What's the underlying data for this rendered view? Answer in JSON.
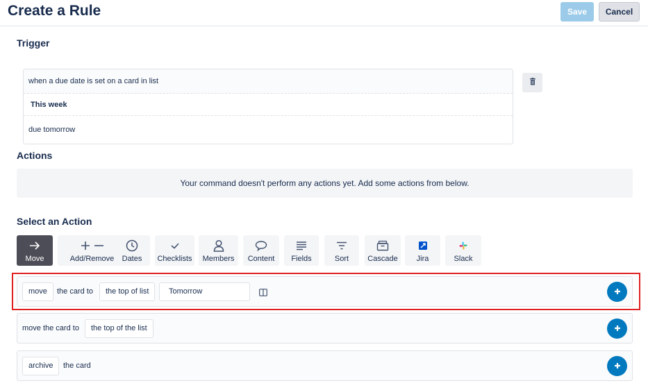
{
  "header": {
    "title": "Create a Rule",
    "save_label": "Save",
    "cancel_label": "Cancel"
  },
  "trigger": {
    "heading": "Trigger",
    "row1": "when a due date is set on a card in list",
    "row2": "This week",
    "row3": "due tomorrow",
    "delete_icon": "trash-icon"
  },
  "actions": {
    "heading": "Actions",
    "empty_message": "Your command doesn't perform any actions yet. Add some actions from below."
  },
  "select_action": {
    "heading": "Select an Action",
    "tabs": [
      {
        "label": "Move",
        "icon": "arrow-right-icon",
        "active": true
      },
      {
        "label": "Add/Remove",
        "icon": "plus-minus-icon",
        "active": false
      },
      {
        "label": "Dates",
        "icon": "clock-icon",
        "active": false
      },
      {
        "label": "Checklists",
        "icon": "checkmark-icon",
        "active": false
      },
      {
        "label": "Members",
        "icon": "person-icon",
        "active": false
      },
      {
        "label": "Content",
        "icon": "speech-bubble-icon",
        "active": false
      },
      {
        "label": "Fields",
        "icon": "lines-icon",
        "active": false
      },
      {
        "label": "Sort",
        "icon": "filter-icon",
        "active": false
      },
      {
        "label": "Cascade",
        "icon": "archive-box-icon",
        "active": false
      },
      {
        "label": "Jira",
        "icon": "jira-icon",
        "active": false
      },
      {
        "label": "Slack",
        "icon": "slack-icon",
        "active": false
      }
    ]
  },
  "action_cards": [
    {
      "verb": "move",
      "text1": "the card to",
      "position": "the top of list",
      "list_value": "Tomorrow",
      "picker_icon": "board-icon"
    },
    {
      "text1": "move the card to",
      "position": "the top of the list"
    },
    {
      "verb": "archive",
      "text1": "the card"
    }
  ],
  "colors": {
    "accent_blue": "#0079bf",
    "save_disabled": "#9ccbe9",
    "highlight_red": "#e02020",
    "active_tab": "#4d4d57"
  }
}
